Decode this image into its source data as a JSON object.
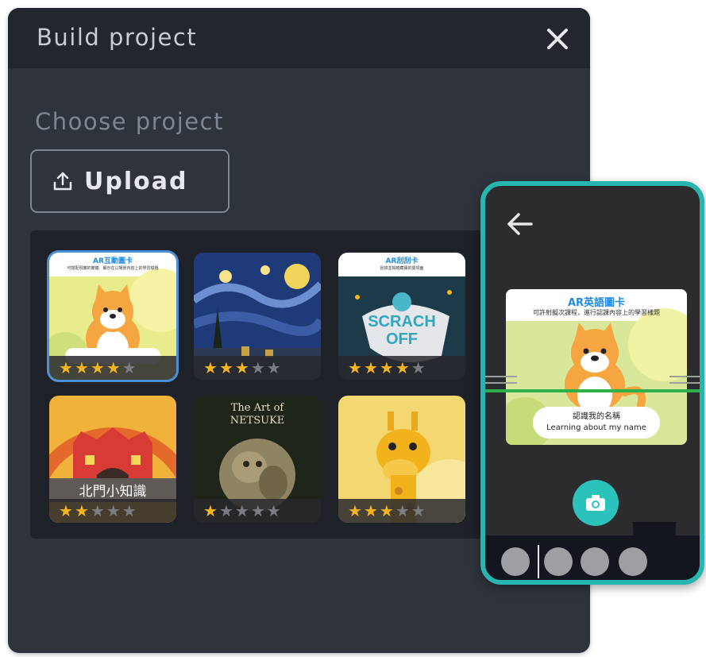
{
  "dialog": {
    "title": "Build project",
    "section_label": "Choose project",
    "upload_label": "Upload"
  },
  "projects": [
    {
      "id": "shiba-card",
      "header_title": "AR互動圖卡",
      "header_sub": "可搭配現實的實體、顯示在以場景內容上的學習樣題",
      "rating": 4,
      "selected": true
    },
    {
      "id": "starry-night",
      "rating": 3,
      "selected": false
    },
    {
      "id": "scratch-off",
      "header_title": "AR刮刮卡",
      "header_sub": "刮掉並揭曉藏寶的獎項面",
      "art_text": "SCRACH OFF",
      "rating": 4,
      "selected": false
    },
    {
      "id": "north-gate",
      "art_text": "北門小知識",
      "rating": 2,
      "selected": false
    },
    {
      "id": "netsuke",
      "art_text_line1": "The Art of",
      "art_text_line2": "NETSUKE",
      "rating": 1,
      "selected": false
    },
    {
      "id": "giraffe",
      "rating": 3,
      "selected": false
    }
  ],
  "phone": {
    "ar_title": "AR英語圖卡",
    "ar_sub": "可許射擬次課程，進行認課內容上的學習樣題",
    "ar_pill_line1": "認識我的名稱",
    "ar_pill_line2": "Learning about my name",
    "thumbnail_count": 4
  },
  "colors": {
    "accent_teal": "#27b5b0",
    "star_on": "#f4b51e",
    "star_off": "#7a7d84",
    "selected_outline": "#4a90d9"
  }
}
